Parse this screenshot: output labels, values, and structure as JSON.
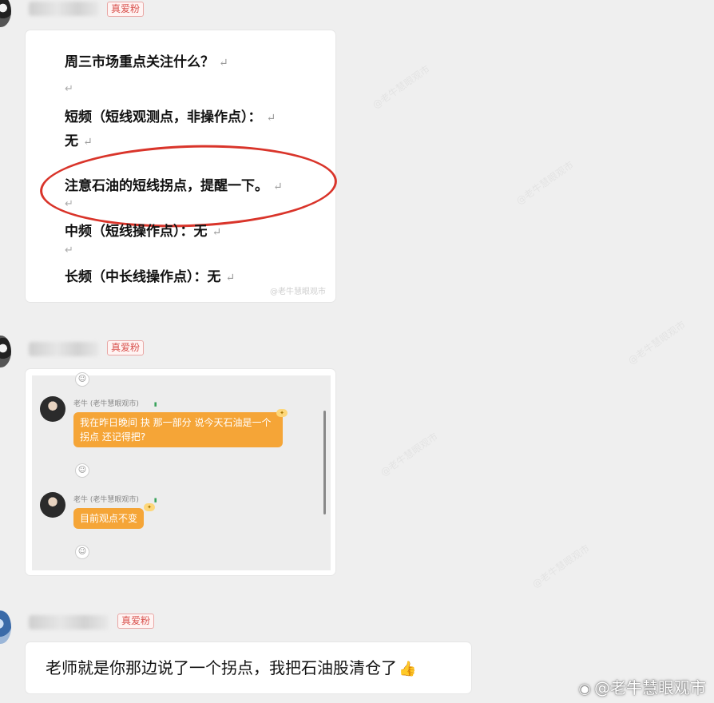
{
  "messages": [
    {
      "badge": "真爱粉",
      "doc_lines": [
        "周三市场重点关注什么？",
        "短频（短线观测点，非操作点）：",
        "无",
        "注意石油的短线拐点，提醒一下。",
        "中频（短线操作点）：无",
        "长频（中长线操作点）：无"
      ],
      "return_mark": "↵",
      "small_watermark": "@老牛慧眼观市"
    },
    {
      "badge": "真爱粉",
      "replies": [
        {
          "name": "老牛 (老牛慧眼观市)",
          "tags": [
            "",
            ""
          ],
          "text": "我在昨日晚间 抉 那一部分 说今天石油是一个拐点 还记得把?",
          "reaction": "☺"
        },
        {
          "name": "老牛 (老牛慧眼观市)",
          "tags": [
            "",
            ""
          ],
          "text": "目前观点不变",
          "reaction": "☺"
        }
      ],
      "top_reaction": "☺"
    },
    {
      "badge": "真爱粉",
      "text": "老师就是你那边说了一个拐点，我把石油股清仓了",
      "emoji": "👍"
    }
  ],
  "footer_watermark": {
    "icon": "weibo-icon",
    "text": "@老牛慧眼观市"
  },
  "colors": {
    "background": "#efefef",
    "badge": "#d9534f",
    "highlight_ring": "#d9342a",
    "reply_bubble": "#f5a537"
  }
}
